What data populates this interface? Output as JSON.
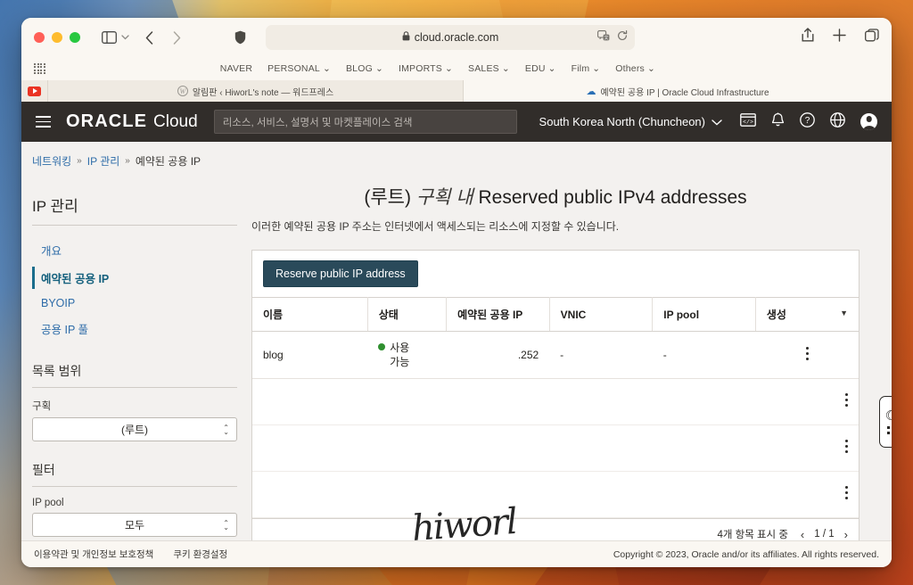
{
  "browser": {
    "url": "cloud.oracle.com",
    "lock_icon": "lock-icon",
    "translate_icon": "translate-icon",
    "reload_icon": "reload-icon",
    "share_icon": "share-icon",
    "newtab_icon": "plus-icon",
    "tabs_overview_icon": "tab-overview-icon",
    "sidebar_icon": "sidebar-icon",
    "back_icon": "back-chevron-icon",
    "forward_icon": "forward-chevron-icon",
    "shield_icon": "privacy-shield-icon",
    "favorites": [
      {
        "label": "NAVER",
        "has_chevron": false
      },
      {
        "label": "PERSONAL",
        "has_chevron": true
      },
      {
        "label": "BLOG",
        "has_chevron": true
      },
      {
        "label": "IMPORTS",
        "has_chevron": true
      },
      {
        "label": "SALES",
        "has_chevron": true
      },
      {
        "label": "EDU",
        "has_chevron": true
      },
      {
        "label": "Film",
        "has_chevron": true
      },
      {
        "label": "Others",
        "has_chevron": true
      }
    ],
    "tabs": [
      {
        "title": "알림판 ‹ HiworL's note — 워드프레스",
        "active": false
      },
      {
        "title": "예약된 공용 IP | Oracle Cloud Infrastructure",
        "active": true
      }
    ]
  },
  "oci_header": {
    "brand_oracle": "ORACLE",
    "brand_cloud": "Cloud",
    "search_placeholder": "리소스, 서비스, 설명서 및 마켓플레이스 검색",
    "region": "South Korea North (Chuncheon)",
    "icons": [
      "cloud-shell-icon",
      "bell-icon",
      "help-icon",
      "globe-icon",
      "user-avatar-icon"
    ]
  },
  "breadcrumb": {
    "items": [
      "네트워킹",
      "IP 관리",
      "예약된 공용 IP"
    ],
    "separator": "»"
  },
  "sidebar": {
    "title": "IP 관리",
    "links": [
      {
        "label": "개요",
        "active": false
      },
      {
        "label": "예약된 공용 IP",
        "active": true
      },
      {
        "label": "BYOIP",
        "active": false
      },
      {
        "label": "공용 IP 풀",
        "active": false
      }
    ],
    "scope": {
      "title": "목록 범위",
      "field_label": "구획",
      "value": "(루트)"
    },
    "filter": {
      "title": "필터",
      "field_label": "IP pool",
      "value": "모두"
    }
  },
  "main": {
    "title_prefix": "(루트)",
    "title_italic": "구획 내",
    "title_main": "Reserved public IPv4 addresses",
    "subtitle": "이러한 예약된 공용 IP 주소는 인터넷에서 액세스되는 리소스에 지정할 수 있습니다.",
    "primary_button": "Reserve public IP address",
    "columns": [
      "이름",
      "상태",
      "예약된 공용 IP",
      "VNIC",
      "IP pool",
      "생성"
    ],
    "rows": [
      {
        "name": "blog",
        "status": "사용\n가능",
        "status_color": "#2f8f2f",
        "reserved_ip": ".252",
        "vnic": "-",
        "ip_pool": "-",
        "created": ""
      }
    ],
    "footer": {
      "count_label": "4개 항목 표시 중",
      "page_label": "1 / 1",
      "prev_icon": "chevron-left-icon",
      "next_icon": "chevron-right-icon"
    },
    "accessibility_widget": {
      "moon_icon": "dark-mode-moon-icon",
      "dots_icon": "accessibility-dots-icon"
    }
  },
  "oci_footer": {
    "links": [
      "이용약관 및 개인정보 보호정책",
      "쿠키 환경설정"
    ],
    "copyright": "Copyright © 2023, Oracle and/or its affiliates. All rights reserved."
  },
  "watermark": {
    "signature": "hiworl"
  }
}
